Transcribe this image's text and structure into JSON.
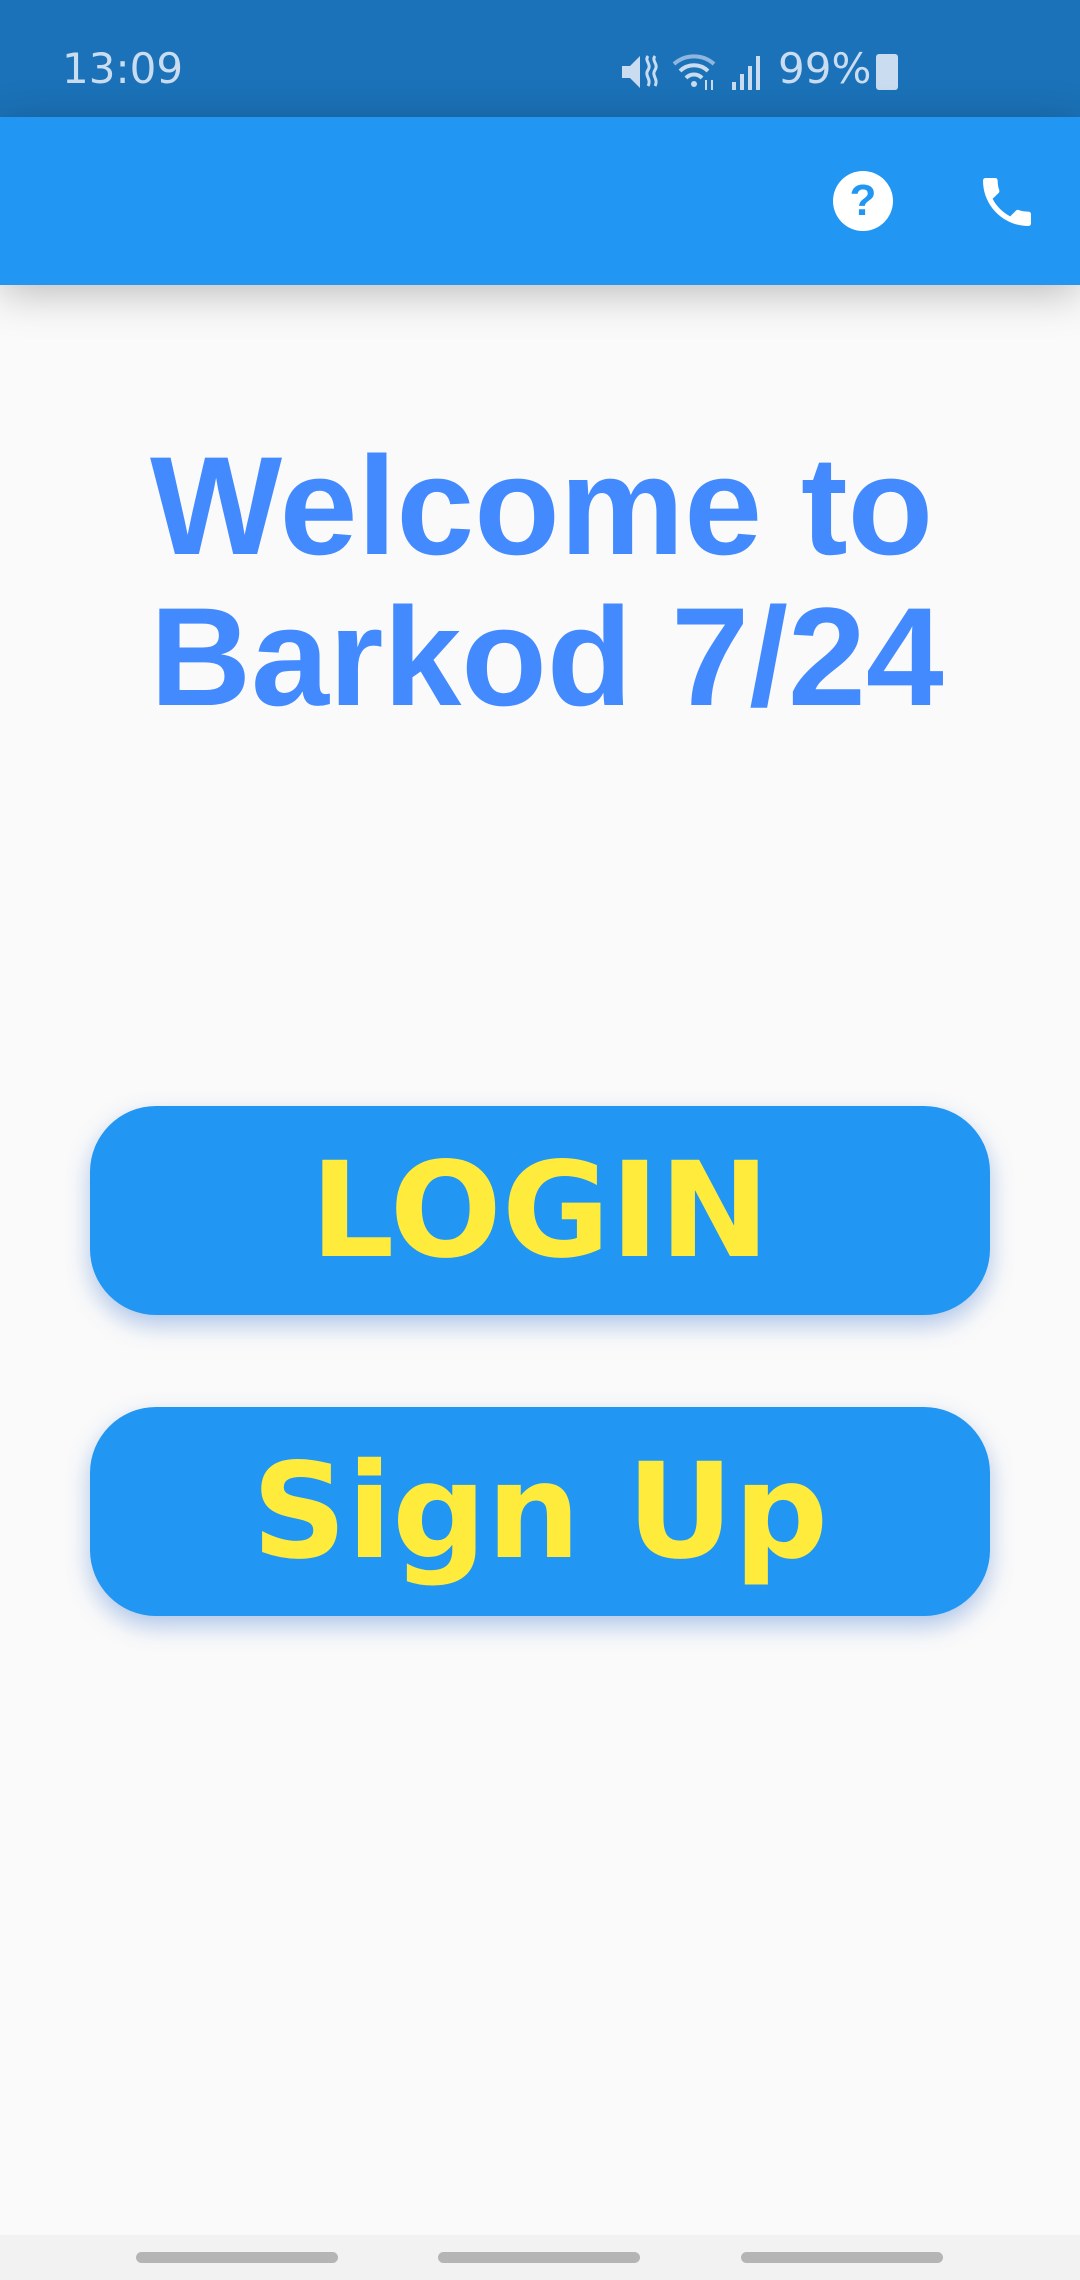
{
  "status_bar": {
    "time": "13:09",
    "battery": "99%",
    "icons": [
      "mute-vibrate-icon",
      "wifi-icon",
      "signal-icon",
      "battery-charging-icon"
    ]
  },
  "app_bar": {
    "icons": [
      "help-icon",
      "phone-icon"
    ],
    "help_glyph": "?"
  },
  "main": {
    "title_line1": "Welcome to",
    "title_line2": "Barkod 7/24",
    "login_label": "LOGIN",
    "signup_label": "Sign Up"
  },
  "colors": {
    "primary": "#2196f3",
    "status_bar": "#1b72b8",
    "title": "#448aff",
    "button_text": "#ffeb3b"
  }
}
